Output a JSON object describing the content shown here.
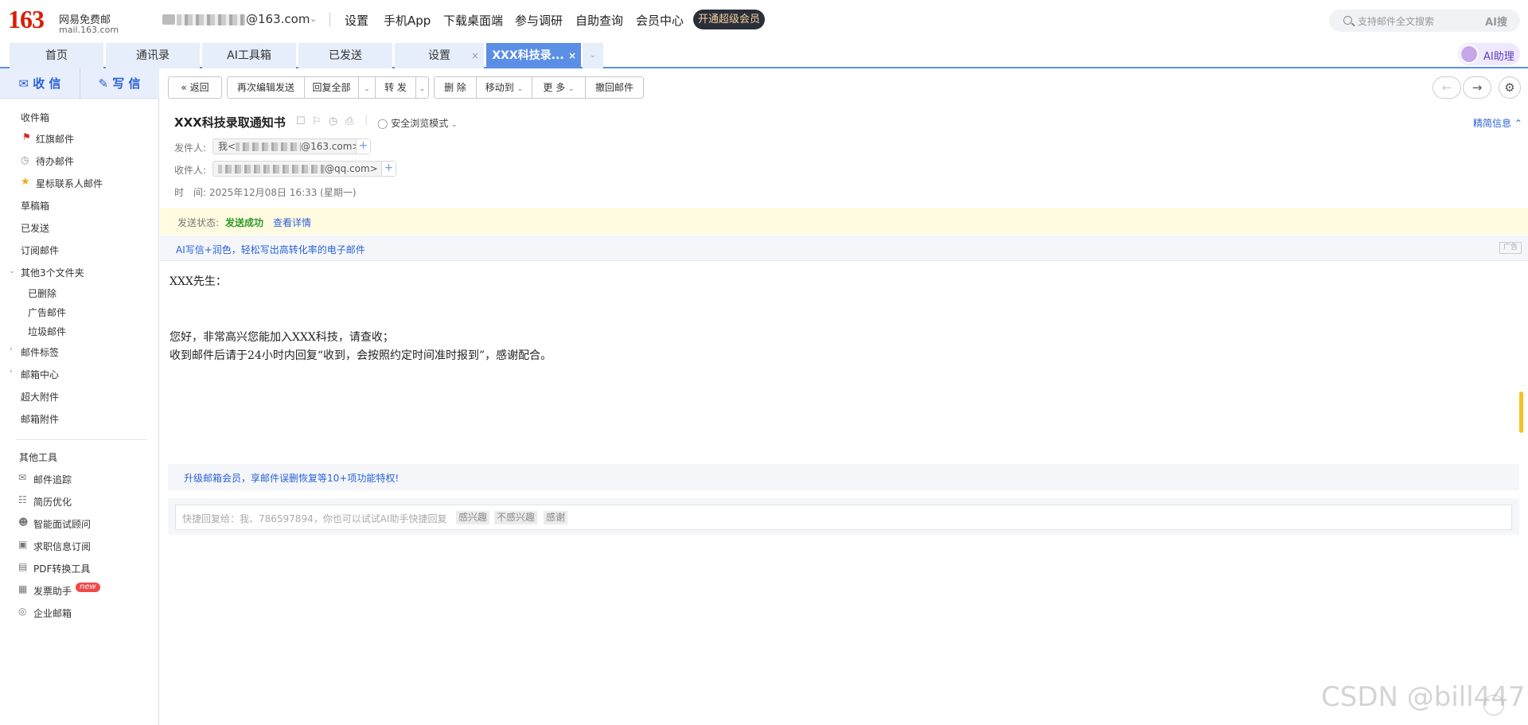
{
  "logo": {
    "number": "163",
    "name": "网易免费邮",
    "url": "mail.163.com"
  },
  "account": {
    "suffix": "@163.com"
  },
  "topnav": [
    "设置",
    "手机App",
    "下载桌面端",
    "参与调研",
    "自助查询",
    "会员中心"
  ],
  "vip_button": "开通超级会员",
  "search": {
    "placeholder": "支持邮件全文搜索",
    "ai_label": "AI搜"
  },
  "tabs": [
    {
      "label": "首页"
    },
    {
      "label": "通讯录"
    },
    {
      "label": "AI工具箱"
    },
    {
      "label": "已发送"
    },
    {
      "label": "设置"
    },
    {
      "label": "XXX科技录..."
    }
  ],
  "ai_assistant": "AI助理",
  "sidebar": {
    "receive": "收 信",
    "compose": "写 信",
    "folders": {
      "inbox": "收件箱",
      "flagged": "红旗邮件",
      "todo": "待办邮件",
      "starred": "星标联系人邮件",
      "drafts": "草稿箱",
      "sent": "已发送",
      "subscriptions": "订阅邮件",
      "other": "其他3个文件夹",
      "deleted": "已删除",
      "ads": "广告邮件",
      "spam": "垃圾邮件",
      "tags": "邮件标签",
      "center": "邮箱中心",
      "big_attach": "超大附件",
      "attachments": "邮箱附件"
    },
    "tools_title": "其他工具",
    "tools": {
      "track": "邮件追踪",
      "resume": "简历优化",
      "interview": "智能面试顾问",
      "jobs": "求职信息订阅",
      "pdf": "PDF转换工具",
      "invoice": "发票助手",
      "enterprise": "企业邮箱"
    },
    "new_badge": "new"
  },
  "toolbar": {
    "back": "返回",
    "reedit": "再次编辑发送",
    "reply_all": "回复全部",
    "forward": "转 发",
    "delete": "删 除",
    "move": "移动到",
    "more": "更 多",
    "recall": "撤回邮件"
  },
  "mail": {
    "subject": "XXX科技录取通知书",
    "safe_mode": "安全浏览模式",
    "brief_info": "精简信息",
    "from_label": "发件人:",
    "from_name": "我<",
    "from_domain": "@163.com>",
    "to_label": "收件人:",
    "to_domain": "@qq.com>",
    "time_label": "时　间:",
    "time_value": "2025年12月08日 16:33 (星期一)",
    "status_label": "发送状态:",
    "status_value": "发送成功",
    "status_link": "查看详情",
    "ad_text": "AI写信+润色，轻松写出高转化率的电子邮件",
    "ad_tag": "广告",
    "body": {
      "greeting": "XXX先生：",
      "line1": "您好，非常高兴您能加入XXX科技，请查收；",
      "line2": "收到邮件后请于24小时内回复“收到，会按照约定时间准时报到”，感谢配合。"
    },
    "promo": "升级邮箱会员，享邮件误删恢复等10+项功能特权!",
    "quick_reply": "快捷回复给：我、786597894，你也可以试试AI助手快捷回复",
    "quick_chips": [
      "感兴趣",
      "不感兴趣",
      "感谢"
    ]
  },
  "watermark": "CSDN @bill447",
  "colors": {
    "brand_red": "#d81e06",
    "accent_blue": "#2b62d8",
    "tab_active": "#5b8fe6",
    "success_green": "#2c9b29"
  }
}
